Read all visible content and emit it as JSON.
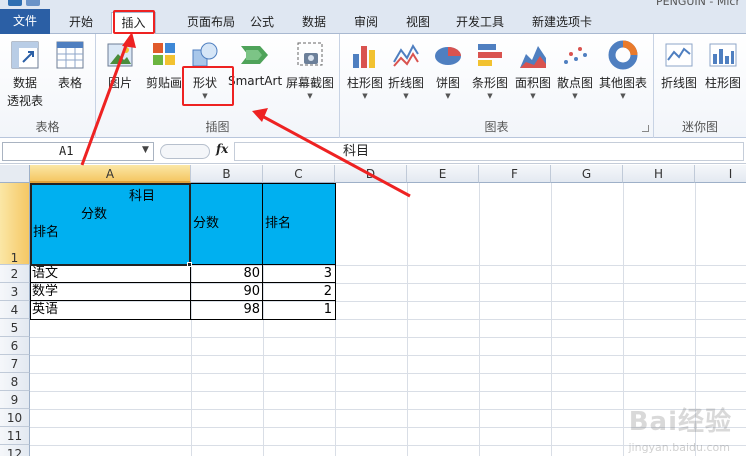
{
  "title_fragment": "PENGUIN - Micr",
  "tabs": [
    {
      "label": "文件"
    },
    {
      "label": "开始"
    },
    {
      "label": "插入"
    },
    {
      "label": "页面布局"
    },
    {
      "label": "公式"
    },
    {
      "label": "数据"
    },
    {
      "label": "审阅"
    },
    {
      "label": "视图"
    },
    {
      "label": "开发工具"
    },
    {
      "label": "新建选项卡"
    }
  ],
  "ribbon": {
    "groups": {
      "tables": "表格",
      "illustrations": "插图",
      "charts": "图表",
      "sparklines": "迷你图"
    },
    "buttons": {
      "pivot_line1": "数据",
      "pivot_line2": "透视表",
      "table": "表格",
      "picture": "图片",
      "clipart": "剪贴画",
      "shapes": "形状",
      "smartart": "SmartArt",
      "screenshot": "屏幕截图",
      "column": "柱形图",
      "line": "折线图",
      "pie": "饼图",
      "bar": "条形图",
      "area": "面积图",
      "scatter": "散点图",
      "other": "其他图表",
      "spark_line": "折线图",
      "spark_column": "柱形图"
    }
  },
  "formula_bar": {
    "name_box": "A1",
    "fx": "fx",
    "content": "科目"
  },
  "sheet": {
    "columns": [
      "A",
      "B",
      "C",
      "D",
      "E",
      "F",
      "G",
      "H",
      "I"
    ],
    "rows": [
      "1",
      "2",
      "3",
      "4",
      "5",
      "6",
      "7",
      "8",
      "9",
      "10",
      "11",
      "12"
    ],
    "header_cell": {
      "subject": "科目",
      "score": "分数",
      "rank": "排名"
    },
    "header_b": "分数",
    "header_c": "排名",
    "data": [
      {
        "subject": "语文",
        "score": "80",
        "rank": "3"
      },
      {
        "subject": "数学",
        "score": "90",
        "rank": "2"
      },
      {
        "subject": "英语",
        "score": "98",
        "rank": "1"
      }
    ],
    "header_fill": "#00b0f0"
  },
  "watermark": {
    "main": "Bai经验",
    "sub": "jingyan.baidu.com"
  }
}
